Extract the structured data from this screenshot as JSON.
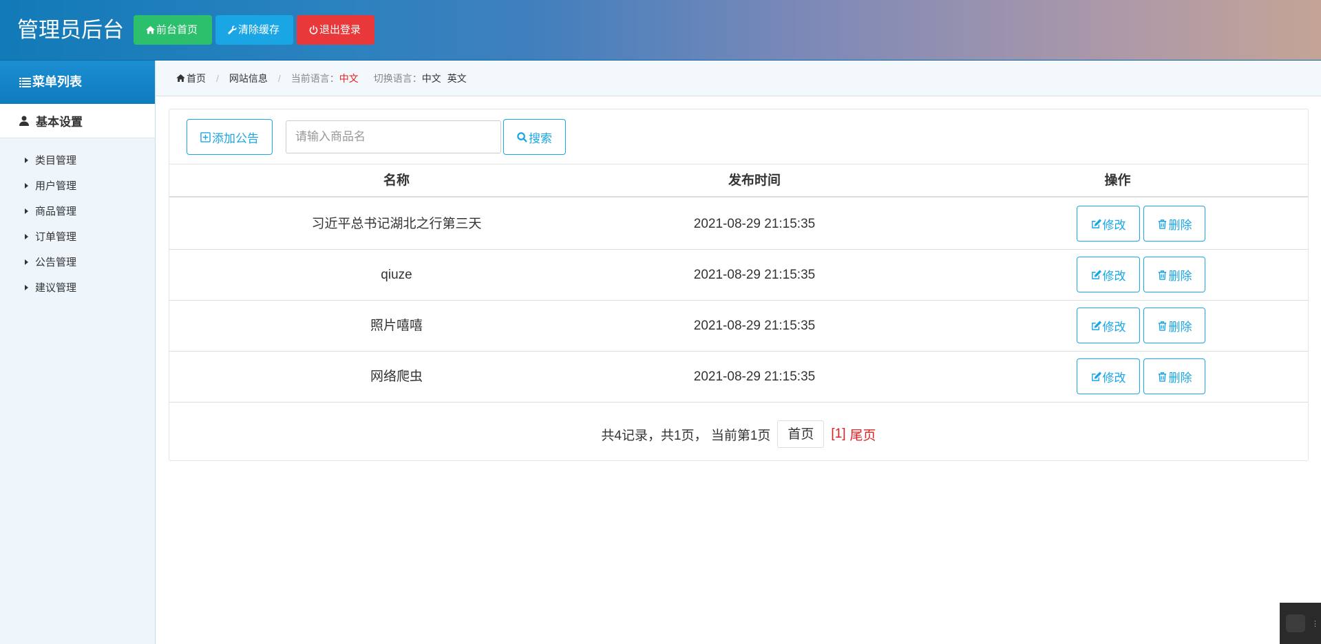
{
  "header": {
    "title": "管理员后台",
    "buttons": {
      "home": "前台首页",
      "clear_cache": "清除缓存",
      "logout": "退出登录"
    },
    "colors": {
      "green": "#2cc06c",
      "blue": "#1aa6e5",
      "red": "#e8383a"
    }
  },
  "sidebar": {
    "menu_title": "菜单列表",
    "group_title": "基本设置",
    "items": [
      {
        "label": "类目管理"
      },
      {
        "label": "用户管理"
      },
      {
        "label": "商品管理"
      },
      {
        "label": "订单管理"
      },
      {
        "label": "公告管理"
      },
      {
        "label": "建议管理"
      }
    ]
  },
  "breadcrumb": {
    "home": "首页",
    "site_info": "网站信息",
    "current_lang_label": "当前语言：",
    "current_lang": "中文",
    "switch_label": "切换语言：",
    "lang_cn": "中文",
    "lang_en": "英文"
  },
  "toolbar": {
    "add_label": "添加公告",
    "search_placeholder": "请输入商品名",
    "search_label": "搜索"
  },
  "table": {
    "headers": {
      "name": "名称",
      "time": "发布时间",
      "ops": "操作"
    },
    "rows": [
      {
        "name": "习近平总书记湖北之行第三天",
        "time": "2021-08-29 21:15:35"
      },
      {
        "name": "qiuze",
        "time": "2021-08-29 21:15:35"
      },
      {
        "name": "照片嘻嘻",
        "time": "2021-08-29 21:15:35"
      },
      {
        "name": "网络爬虫",
        "time": "2021-08-29 21:15:35"
      }
    ],
    "edit_label": "修改",
    "delete_label": "删除"
  },
  "pagination": {
    "info": "共4记录，共1页， 当前第1页",
    "first": "首页",
    "current": "[1]",
    "last": "尾页"
  },
  "icons": {
    "home": "home-icon",
    "wrench": "wrench-icon",
    "power": "power-icon",
    "list": "list-icon",
    "user": "user-icon",
    "plus_square": "plus-square-icon",
    "search": "search-icon",
    "edit": "edit-icon",
    "trash": "trash-icon"
  }
}
